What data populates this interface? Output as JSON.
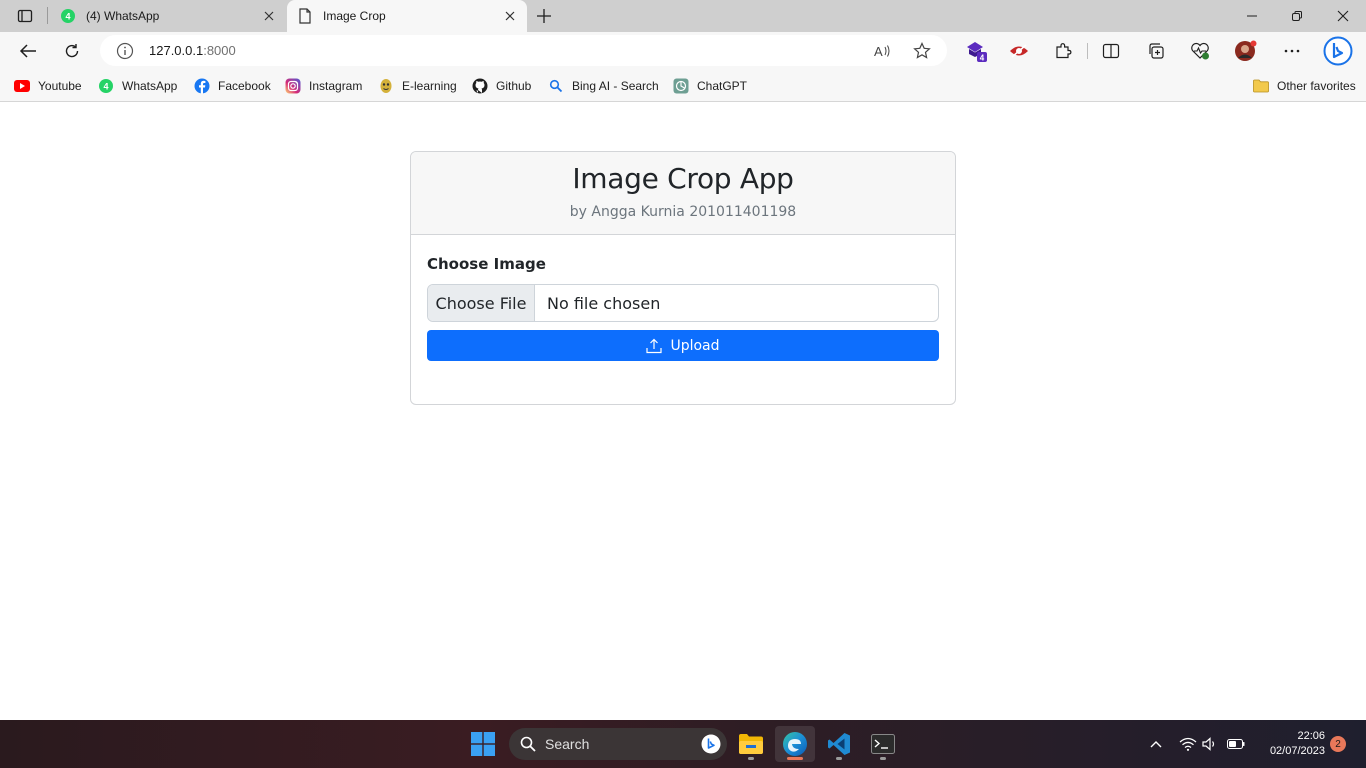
{
  "browser": {
    "tabs": [
      {
        "title": "(4) WhatsApp",
        "favicon": "whatsapp-icon",
        "badge": "4"
      },
      {
        "title": "Image Crop",
        "favicon": "page-icon"
      }
    ],
    "address_bar": {
      "host": "127.0.0.1",
      "port": ":8000"
    },
    "extension_badge": "4",
    "bookmarks": [
      {
        "label": "Youtube",
        "icon": "youtube-icon"
      },
      {
        "label": "WhatsApp",
        "icon": "whatsapp-icon",
        "badge": "4"
      },
      {
        "label": "Facebook",
        "icon": "facebook-icon"
      },
      {
        "label": "Instagram",
        "icon": "instagram-icon"
      },
      {
        "label": "E-learning",
        "icon": "elearning-icon"
      },
      {
        "label": "Github",
        "icon": "github-icon"
      },
      {
        "label": "Bing AI - Search",
        "icon": "search-icon"
      },
      {
        "label": "ChatGPT",
        "icon": "chatgpt-icon"
      }
    ],
    "other_favorites": "Other favorites"
  },
  "app": {
    "title": "Image Crop App",
    "subtitle": "by Angga Kurnia 201011401198",
    "choose_label": "Choose Image",
    "file_button": "Choose File",
    "file_status": "No file chosen",
    "upload_label": "Upload"
  },
  "taskbar": {
    "search_placeholder": "Search",
    "time": "22:06",
    "date": "02/07/2023",
    "notification_count": "2"
  },
  "colors": {
    "primary": "#0d6efd",
    "card_header_bg": "#f7f7f7",
    "subtitle_text": "#6c757d"
  }
}
